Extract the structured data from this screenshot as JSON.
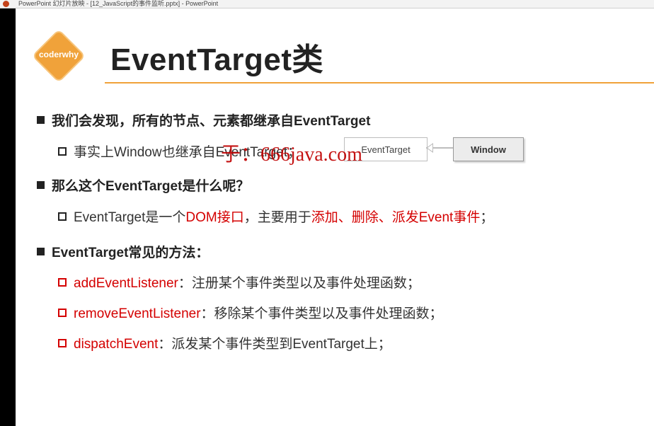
{
  "window": {
    "title": "PowerPoint 幻灯片放映 - [12_JavaScript的事件监听.pptx] - PowerPoint"
  },
  "slide": {
    "logo_text": "coderwhy",
    "title": "EventTarget类",
    "items": [
      {
        "text": "我们会发现，所有的节点、元素都继承自EventTarget"
      },
      {
        "text": "事实上Window也继承自EventTarget；"
      },
      {
        "text": "那么这个EventTarget是什么呢？"
      },
      {
        "text_a": "EventTarget是一个",
        "text_b": "DOM接口",
        "text_c": "，主要用于",
        "text_d": "添加、删除、派发Event事件",
        "text_e": "；"
      },
      {
        "text": "EventTarget常见的方法："
      },
      {
        "method": "addEventListener",
        "desc": "：注册某个事件类型以及事件处理函数；"
      },
      {
        "method": "removeEventListener",
        "desc": "：移除某个事件类型以及事件处理函数；"
      },
      {
        "method": "dispatchEvent",
        "desc": "：派发某个事件类型到EventTarget上；"
      }
    ],
    "diagram": {
      "parent": "EventTarget",
      "child": "Window"
    },
    "watermark": "于：666java.com",
    "colors": {
      "accent": "#f0a23a",
      "highlight": "#d40000"
    }
  }
}
